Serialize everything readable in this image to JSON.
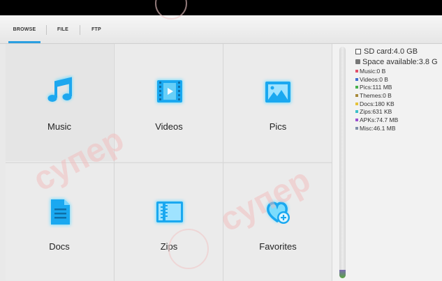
{
  "tabs": [
    {
      "label": "BROWSE",
      "active": true
    },
    {
      "label": "FILE",
      "active": false
    },
    {
      "label": "FTP",
      "active": false
    }
  ],
  "categories": [
    {
      "label": "Music",
      "icon": "music-note-icon"
    },
    {
      "label": "Videos",
      "icon": "film-strip-icon"
    },
    {
      "label": "Pics",
      "icon": "picture-icon"
    },
    {
      "label": "Docs",
      "icon": "document-icon"
    },
    {
      "label": "Zips",
      "icon": "zip-archive-icon"
    },
    {
      "label": "Favorites",
      "icon": "heart-plus-icon"
    }
  ],
  "storage": {
    "sd_card": "SD card:4.0 GB",
    "space_available": "Space available:3.8 G",
    "items": [
      {
        "text": "Music:0 B",
        "color": "#e0506a"
      },
      {
        "text": "Videos:0 B",
        "color": "#3f6fd0"
      },
      {
        "text": "Pics:111 MB",
        "color": "#45b04a"
      },
      {
        "text": "Themes:0 B",
        "color": "#a88a3a"
      },
      {
        "text": "Docs:180 KB",
        "color": "#e6c23a"
      },
      {
        "text": "Zips:631 KB",
        "color": "#3cc0c8"
      },
      {
        "text": "APKs:74.7 MB",
        "color": "#9a4fd0"
      },
      {
        "text": "Misc:46.1 MB",
        "color": "#7f8fa8"
      }
    ]
  },
  "watermark": "супер",
  "colors": {
    "accent": "#2a9fe0",
    "icon_glow": "#33c4ff"
  }
}
